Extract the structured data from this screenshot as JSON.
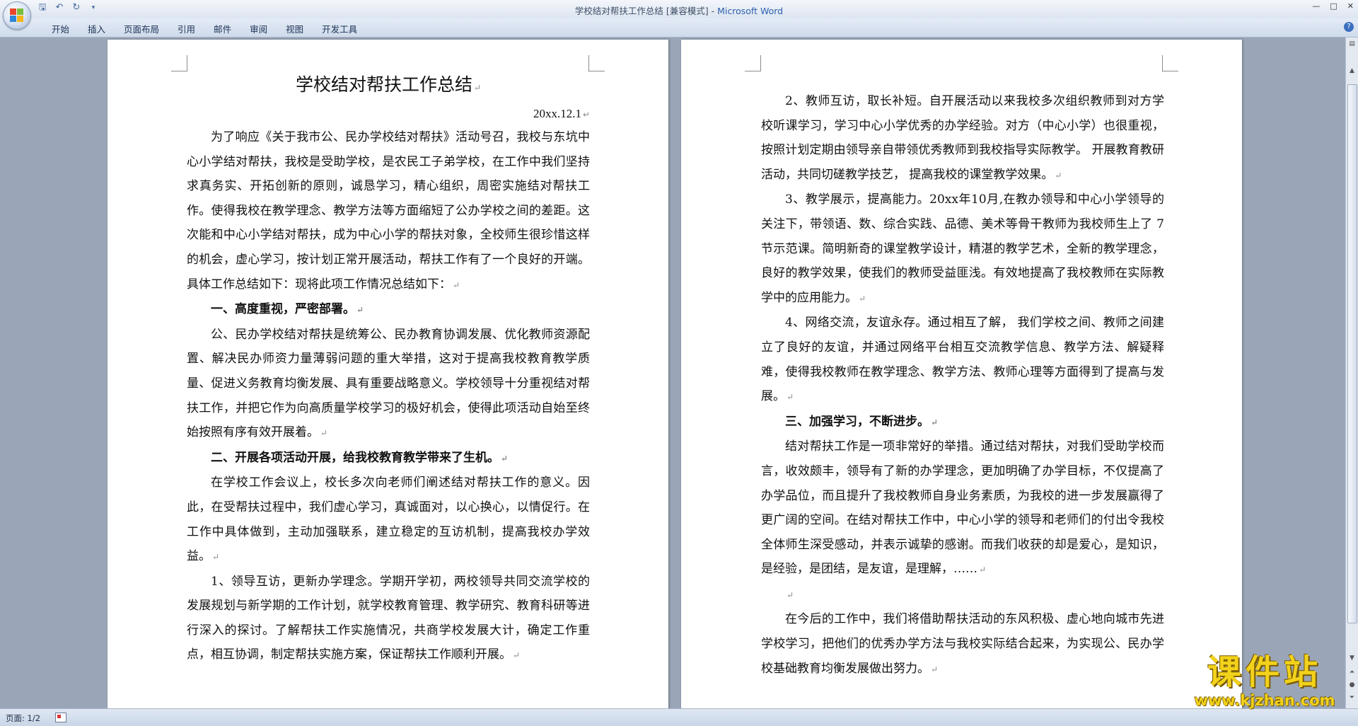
{
  "window": {
    "title_prefix": "学校结对帮扶工作总结 [兼容模式] - ",
    "title_app": "Microsoft Word"
  },
  "ribbon": {
    "tabs": [
      "开始",
      "插入",
      "页面布局",
      "引用",
      "邮件",
      "审阅",
      "视图",
      "开发工具"
    ]
  },
  "colors": {
    "workspace": "#9aa6b8",
    "ribbon": "#dde5f0",
    "watermark": "#f2d21b"
  },
  "document": {
    "title": "学校结对帮扶工作总结",
    "date": "20xx.12.1",
    "page1": [
      {
        "text": "为了响应《关于我市公、民办学校结对帮扶》活动号召，我校与东坑中心小学结对帮扶，我校是受助学校，是农民工子弟学校，在工作中我们坚持求真务实、开拓创新的原则，诚恳学习，精心组织，周密实施结对帮扶工作。使得我校在教学理念、教学方法等方面缩短了公办学校之间的差距。这次能和中心小学结对帮扶，成为中心小学的帮扶对象，全校师生很珍惜这样的机会，虚心学习，按计划正常开展活动，帮扶工作有了一个良好的开端。具体工作总结如下：现将此项工作情况总结如下：",
        "bold": false
      },
      {
        "text": "一、高度重视，严密部署。",
        "bold": true
      },
      {
        "text": "公、民办学校结对帮扶是统筹公、民办教育协调发展、优化教师资源配置、解决民办师资力量薄弱问题的重大举措，这对于提高我校教育教学质量、促进义务教育均衡发展、具有重要战略意义。学校领导十分重视结对帮扶工作，并把它作为向高质量学校学习的极好机会，使得此项活动自始至终始按照有序有效开展着。",
        "bold": false
      },
      {
        "text": "二、开展各项活动开展，给我校教育教学带来了生机。",
        "bold": true
      },
      {
        "text": "在学校工作会议上，校长多次向老师们阐述结对帮扶工作的意义。因此，在受帮扶过程中，我们虚心学习，真诚面对，以心换心，以情促行。在工作中具体做到，主动加强联系，建立稳定的互访机制，提高我校办学效益。",
        "bold": false
      },
      {
        "text": "1、领导互访，更新办学理念。学期开学初，两校领导共同交流学校的发展规划与新学期的工作计划，就学校教育管理、教学研究、教育科研等进行深入的探讨。了解帮扶工作实施情况，共商学校发展大计，确定工作重点，相互协调，制定帮扶实施方案，保证帮扶工作顺利开展。",
        "bold": false
      }
    ],
    "page2": [
      {
        "text": "2、教师互访，取长补短。自开展活动以来我校多次组织教师到对方学校听课学习，学习中心小学优秀的办学经验。对方（中心小学）也很重视，按照计划定期由领导亲自带领优秀教师到我校指导实际教学。 开展教育教研活动，共同切磋教学技艺， 提高我校的课堂教学效果。",
        "bold": false
      },
      {
        "text": "3、教学展示，提高能力。20xx年10月,在教办领导和中心小学领导的关注下，带领语、数、综合实践、品德、美术等骨干教师为我校师生上了 7 节示范课。简明新奇的课堂教学设计，精湛的教学艺术，全新的教学理念，良好的教学效果，使我们的教师受益匪浅。有效地提高了我校教师在实际教学中的应用能力。",
        "bold": false
      },
      {
        "text": "4、网络交流，友谊永存。通过相互了解， 我们学校之间、教师之间建立了良好的友谊，并通过网络平台相互交流教学信息、教学方法、解疑释难，使得我校教师在教学理念、教学方法、教师心理等方面得到了提高与发展。",
        "bold": true
      },
      {
        "text": "三、加强学习，不断进步。",
        "bold": true
      },
      {
        "text": "结对帮扶工作是一项非常好的举措。通过结对帮扶，对我们受助学校而言，收效颇丰，领导有了新的办学理念，更加明确了办学目标，不仅提高了办学品位，而且提升了我校教师自身业务素质，为我校的进一步发展赢得了更广阔的空间。在结对帮扶工作中，中心小学的领导和老师们的付出令我校全体师生深受感动，并表示诚挚的感谢。而我们收获的却是爱心，是知识，是经验，是团结，是友谊，是理解，……",
        "bold": false
      },
      {
        "text": "",
        "bold": false
      },
      {
        "text": "在今后的工作中，我们将借助帮扶活动的东风积极、虚心地向城市先进学校学习，把他们的优秀办学方法与我校实际结合起来，为实现公、民办学校基础教育均衡发展做出努力。",
        "bold": false
      }
    ]
  },
  "status": {
    "page": "页面: 1/2"
  },
  "watermark": {
    "main": "课件站",
    "url": "www.kjzhan.com"
  }
}
